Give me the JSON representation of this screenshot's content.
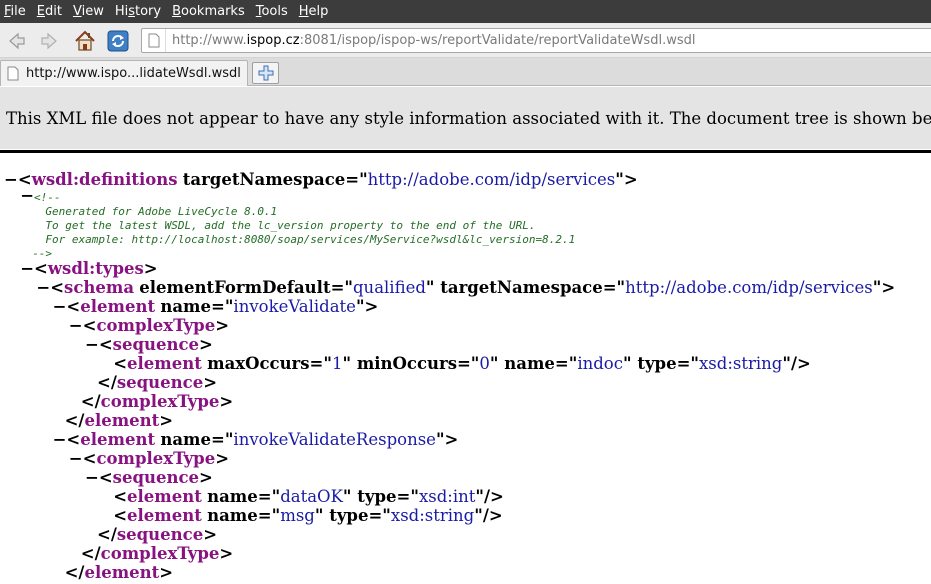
{
  "menubar": {
    "items": [
      {
        "acc": "F",
        "rest": "ile"
      },
      {
        "acc": "E",
        "rest": "dit"
      },
      {
        "acc": "V",
        "rest": "iew"
      },
      {
        "pre": "Hi",
        "acc": "s",
        "rest": "tory"
      },
      {
        "acc": "B",
        "rest": "ookmarks"
      },
      {
        "acc": "T",
        "rest": "ools"
      },
      {
        "acc": "H",
        "rest": "elp"
      }
    ]
  },
  "navbar": {
    "url_prefix": "http://www.",
    "url_host": "ispop.cz",
    "url_rest": ":8081/ispop/ispop-ws/reportValidate/reportValidateWsdl.wsdl"
  },
  "tab": {
    "title": "http://www.ispo...lidateWsdl.wsdl"
  },
  "banner": {
    "text": "This XML file does not appear to have any style information associated with it. The document tree is shown below."
  },
  "xml": {
    "toggle": "−",
    "lines": [
      {
        "indent": 0,
        "toggle": true,
        "parts": [
          [
            "p",
            "<"
          ],
          [
            "t",
            "wsdl:definitions"
          ],
          [
            "s",
            " "
          ],
          [
            "a",
            "targetNamespace"
          ],
          [
            "p",
            "=\""
          ],
          [
            "v",
            "http://adobe.com/idp/services"
          ],
          [
            "p",
            "\">"
          ]
        ]
      },
      {
        "indent": 1,
        "toggle": true,
        "comment_open": "<!--"
      },
      {
        "indent": 2,
        "comment": "Generated for Adobe LiveCycle 8.0.1"
      },
      {
        "indent": 2,
        "comment": "To get the latest WSDL, add the lc_version property to the end of the URL."
      },
      {
        "indent": 2,
        "comment": "For example: http://localhost:8080/soap/services/MyService?wsdl&lc_version=8.2.1"
      },
      {
        "indent": 1,
        "comment_close": "-->"
      },
      {
        "indent": 1,
        "toggle": true,
        "parts": [
          [
            "p",
            "<"
          ],
          [
            "t",
            "wsdl:types"
          ],
          [
            "p",
            ">"
          ]
        ]
      },
      {
        "indent": 2,
        "toggle": true,
        "parts": [
          [
            "p",
            "<"
          ],
          [
            "t",
            "schema"
          ],
          [
            "s",
            " "
          ],
          [
            "a",
            "elementFormDefault"
          ],
          [
            "p",
            "=\""
          ],
          [
            "v",
            "qualified"
          ],
          [
            "p",
            "\" "
          ],
          [
            "a",
            "targetNamespace"
          ],
          [
            "p",
            "=\""
          ],
          [
            "v",
            "http://adobe.com/idp/services"
          ],
          [
            "p",
            "\">"
          ]
        ]
      },
      {
        "indent": 3,
        "toggle": true,
        "parts": [
          [
            "p",
            "<"
          ],
          [
            "t",
            "element"
          ],
          [
            "s",
            " "
          ],
          [
            "a",
            "name"
          ],
          [
            "p",
            "=\""
          ],
          [
            "v",
            "invokeValidate"
          ],
          [
            "p",
            "\">"
          ]
        ]
      },
      {
        "indent": 4,
        "toggle": true,
        "parts": [
          [
            "p",
            "<"
          ],
          [
            "t",
            "complexType"
          ],
          [
            "p",
            ">"
          ]
        ]
      },
      {
        "indent": 5,
        "toggle": true,
        "parts": [
          [
            "p",
            "<"
          ],
          [
            "t",
            "sequence"
          ],
          [
            "p",
            ">"
          ]
        ]
      },
      {
        "indent": 6,
        "parts": [
          [
            "p",
            "<"
          ],
          [
            "t",
            "element"
          ],
          [
            "s",
            " "
          ],
          [
            "a",
            "maxOccurs"
          ],
          [
            "p",
            "=\""
          ],
          [
            "v",
            "1"
          ],
          [
            "p",
            "\" "
          ],
          [
            "a",
            "minOccurs"
          ],
          [
            "p",
            "=\""
          ],
          [
            "v",
            "0"
          ],
          [
            "p",
            "\" "
          ],
          [
            "a",
            "name"
          ],
          [
            "p",
            "=\""
          ],
          [
            "v",
            "indoc"
          ],
          [
            "p",
            "\" "
          ],
          [
            "a",
            "type"
          ],
          [
            "p",
            "=\""
          ],
          [
            "v",
            "xsd:string"
          ],
          [
            "p",
            "\"/>"
          ]
        ]
      },
      {
        "indent": 5,
        "close": true,
        "parts": [
          [
            "p",
            "</"
          ],
          [
            "t",
            "sequence"
          ],
          [
            "p",
            ">"
          ]
        ]
      },
      {
        "indent": 4,
        "close": true,
        "parts": [
          [
            "p",
            "</"
          ],
          [
            "t",
            "complexType"
          ],
          [
            "p",
            ">"
          ]
        ]
      },
      {
        "indent": 3,
        "close": true,
        "parts": [
          [
            "p",
            "</"
          ],
          [
            "t",
            "element"
          ],
          [
            "p",
            ">"
          ]
        ]
      },
      {
        "indent": 3,
        "toggle": true,
        "parts": [
          [
            "p",
            "<"
          ],
          [
            "t",
            "element"
          ],
          [
            "s",
            " "
          ],
          [
            "a",
            "name"
          ],
          [
            "p",
            "=\""
          ],
          [
            "v",
            "invokeValidateResponse"
          ],
          [
            "p",
            "\">"
          ]
        ]
      },
      {
        "indent": 4,
        "toggle": true,
        "parts": [
          [
            "p",
            "<"
          ],
          [
            "t",
            "complexType"
          ],
          [
            "p",
            ">"
          ]
        ]
      },
      {
        "indent": 5,
        "toggle": true,
        "parts": [
          [
            "p",
            "<"
          ],
          [
            "t",
            "sequence"
          ],
          [
            "p",
            ">"
          ]
        ]
      },
      {
        "indent": 6,
        "parts": [
          [
            "p",
            "<"
          ],
          [
            "t",
            "element"
          ],
          [
            "s",
            " "
          ],
          [
            "a",
            "name"
          ],
          [
            "p",
            "=\""
          ],
          [
            "v",
            "dataOK"
          ],
          [
            "p",
            "\" "
          ],
          [
            "a",
            "type"
          ],
          [
            "p",
            "=\""
          ],
          [
            "v",
            "xsd:int"
          ],
          [
            "p",
            "\"/>"
          ]
        ]
      },
      {
        "indent": 6,
        "parts": [
          [
            "p",
            "<"
          ],
          [
            "t",
            "element"
          ],
          [
            "s",
            " "
          ],
          [
            "a",
            "name"
          ],
          [
            "p",
            "=\""
          ],
          [
            "v",
            "msg"
          ],
          [
            "p",
            "\" "
          ],
          [
            "a",
            "type"
          ],
          [
            "p",
            "=\""
          ],
          [
            "v",
            "xsd:string"
          ],
          [
            "p",
            "\"/>"
          ]
        ]
      },
      {
        "indent": 5,
        "close": true,
        "parts": [
          [
            "p",
            "</"
          ],
          [
            "t",
            "sequence"
          ],
          [
            "p",
            ">"
          ]
        ]
      },
      {
        "indent": 4,
        "close": true,
        "parts": [
          [
            "p",
            "</"
          ],
          [
            "t",
            "complexType"
          ],
          [
            "p",
            ">"
          ]
        ]
      },
      {
        "indent": 3,
        "close": true,
        "parts": [
          [
            "p",
            "</"
          ],
          [
            "t",
            "element"
          ],
          [
            "p",
            ">"
          ]
        ]
      }
    ]
  }
}
